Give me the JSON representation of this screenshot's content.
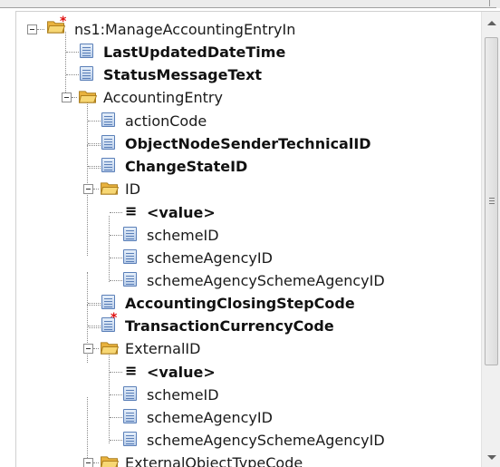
{
  "tree": {
    "root": "ns1:ManageAccountingEntryIn",
    "nodes": [
      {
        "label": "LastUpdatedDateTime",
        "bold": true,
        "icon": "doc"
      },
      {
        "label": "StatusMessageText",
        "bold": true,
        "icon": "doc"
      },
      {
        "label": "AccountingEntry",
        "bold": false,
        "icon": "folder"
      },
      {
        "label": "actionCode",
        "bold": false,
        "icon": "doc"
      },
      {
        "label": "ObjectNodeSenderTechnicalID",
        "bold": true,
        "icon": "doc"
      },
      {
        "label": "ChangeStateID",
        "bold": true,
        "icon": "doc"
      },
      {
        "label": "ID",
        "bold": false,
        "icon": "folder"
      },
      {
        "label": "<value>",
        "bold": true,
        "icon": "menu"
      },
      {
        "label": "schemeID",
        "bold": false,
        "icon": "doc"
      },
      {
        "label": "schemeAgencyID",
        "bold": false,
        "icon": "doc"
      },
      {
        "label": "schemeAgencySchemeAgencyID",
        "bold": false,
        "icon": "doc"
      },
      {
        "label": "AccountingClosingStepCode",
        "bold": true,
        "icon": "doc"
      },
      {
        "label": "TransactionCurrencyCode",
        "bold": true,
        "icon": "doc-required"
      },
      {
        "label": "ExternalID",
        "bold": false,
        "icon": "folder"
      },
      {
        "label": "<value>",
        "bold": true,
        "icon": "menu"
      },
      {
        "label": "schemeID",
        "bold": false,
        "icon": "doc"
      },
      {
        "label": "schemeAgencyID",
        "bold": false,
        "icon": "doc"
      },
      {
        "label": "schemeAgencySchemeAgencyID",
        "bold": false,
        "icon": "doc"
      },
      {
        "label": "ExternalObjectTypeCode",
        "bold": false,
        "icon": "folder"
      }
    ]
  },
  "colors": {
    "required_star": "#e01010",
    "folder": "#f2c84b",
    "doc_border": "#5a7fb8"
  }
}
